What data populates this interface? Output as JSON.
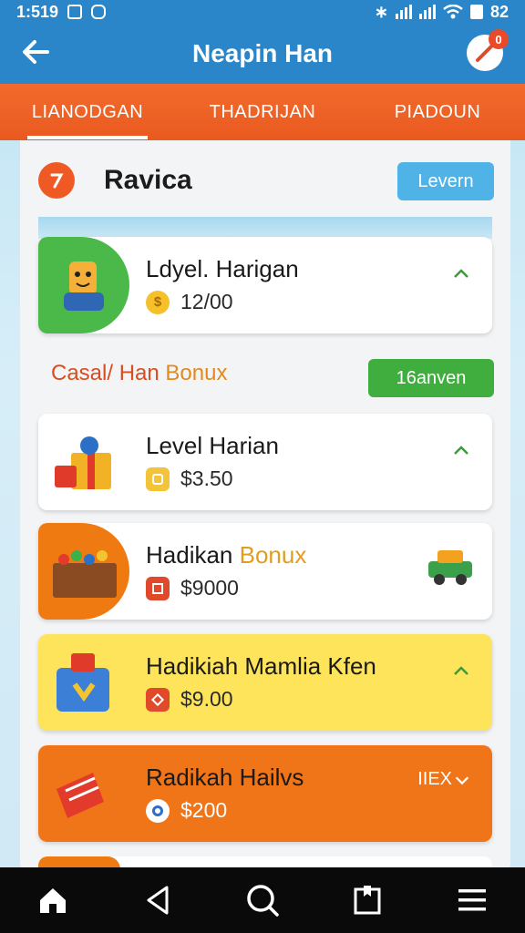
{
  "status_bar": {
    "time": "1:519",
    "battery": "82"
  },
  "app_bar": {
    "title": "Neapin Han",
    "notif_count": "0"
  },
  "tabs": [
    {
      "label": "LIANODGAN",
      "active": true
    },
    {
      "label": "THADRIJAN",
      "active": false
    },
    {
      "label": "PIADOUN",
      "active": false
    }
  ],
  "section": {
    "title": "Ravica",
    "button_label": "Levern"
  },
  "featured": {
    "name": "Ldyel. Harigan",
    "price": "12/00"
  },
  "sub_header": {
    "part_a": "Casal/ Han ",
    "part_b": "Bonux",
    "button_label": "16anven"
  },
  "items": [
    {
      "name": "Level Harian",
      "price": "$3.50"
    },
    {
      "name_a": "Hadikan ",
      "name_b": "Bonux",
      "price": "$9000"
    },
    {
      "name": "Hadikiah Mamlia Kfen",
      "price": "$9.00"
    },
    {
      "name": "Radikah Hailvs",
      "price": "$200",
      "extra": "IIEX"
    }
  ],
  "colors": {
    "primary": "#2a86c8",
    "tabs": "#ef5f24",
    "green": "#3fae3f",
    "yellow": "#fde45a",
    "orange": "#f07418"
  },
  "nav": [
    "home-icon",
    "back-icon",
    "search-icon",
    "recents-icon",
    "menu-icon"
  ]
}
